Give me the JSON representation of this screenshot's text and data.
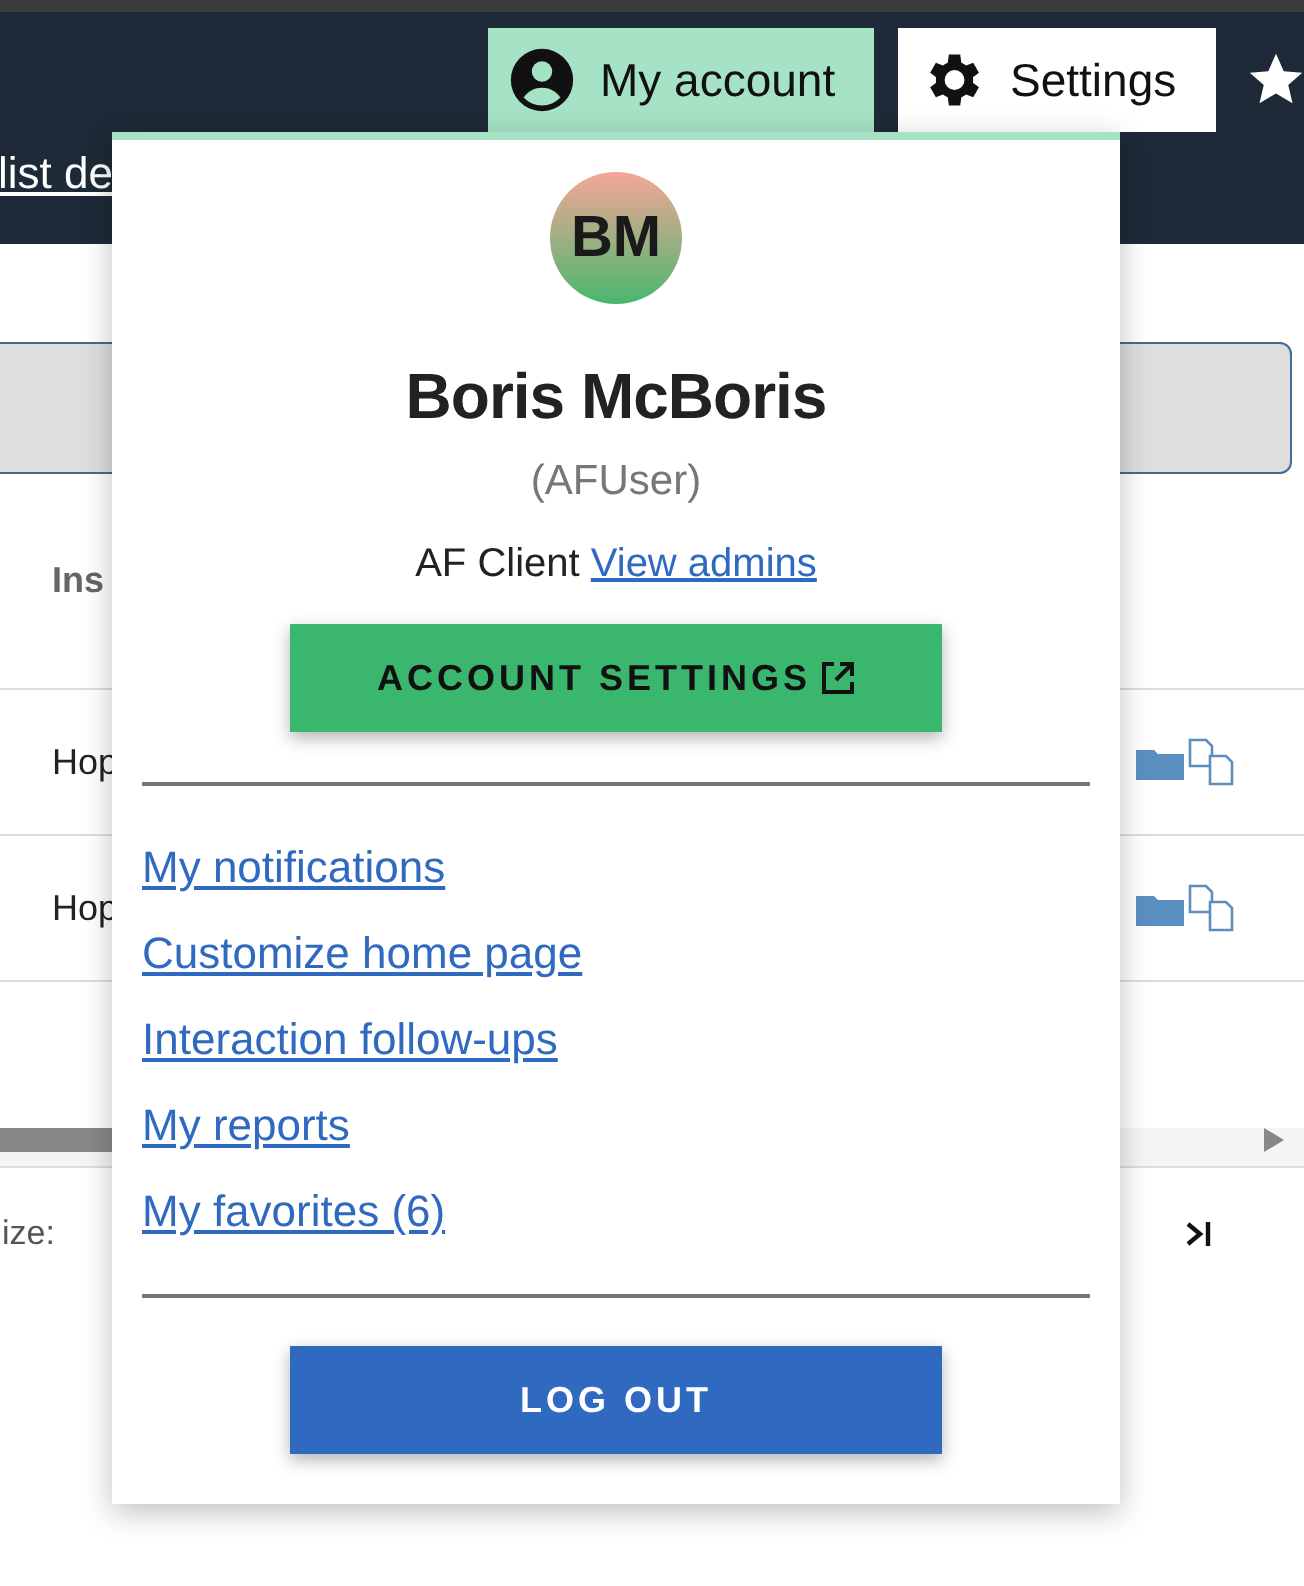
{
  "top_bar": {
    "nav": [
      {
        "label": "My account",
        "kind": "account",
        "selected": true
      },
      {
        "label": "Settings",
        "kind": "gear",
        "selected": false
      }
    ],
    "link": "list de"
  },
  "table": {
    "columns": [
      "Ins"
    ],
    "rows": [
      {
        "cell": "Hop"
      },
      {
        "cell": "Hop"
      }
    ]
  },
  "pager": {
    "label": "ize:"
  },
  "account_menu": {
    "avatar": "BM",
    "name": "Boris McBoris",
    "role": "(AFUser)",
    "client": "AF Client",
    "admins_link": "View admins",
    "settings_button": "ACCOUNT SETTINGS",
    "links": [
      "My notifications",
      "Customize home page",
      "Interaction follow-ups",
      "My reports",
      "My favorites (6)"
    ],
    "logout": "LOG OUT"
  }
}
